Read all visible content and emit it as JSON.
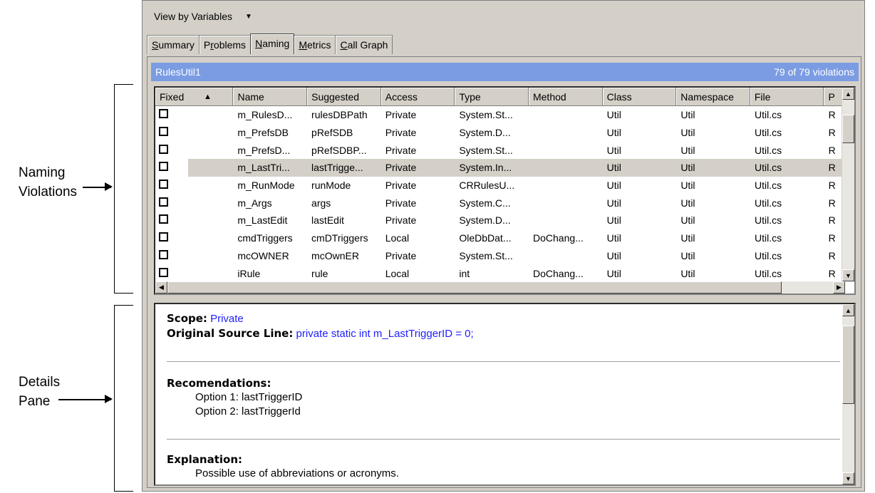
{
  "annotations": {
    "naming_violations": [
      "Naming",
      "Violations"
    ],
    "details_pane": [
      "Details",
      "Pane"
    ]
  },
  "toolbar": {
    "view_label": "View by Variables"
  },
  "tabs": [
    "Summary",
    "Problems",
    "Naming",
    "Metrics",
    "Call Graph"
  ],
  "tabs_active": "Naming",
  "banner": {
    "title": "RulesUtil1",
    "count": "79 of 79 violations",
    "color": "#7b9ce3"
  },
  "grid": {
    "columns": [
      "Fixed",
      "Name",
      "Suggested",
      "Access",
      "Type",
      "Method",
      "Class",
      "Namespace",
      "File",
      "P"
    ],
    "rows": [
      [
        "",
        "m_RulesD...",
        "rulesDBPath",
        "Private",
        "System.St...",
        "",
        "Util",
        "Util",
        "Util.cs",
        "R"
      ],
      [
        "",
        "m_PrefsDB",
        "pRefSDB",
        "Private",
        "System.D...",
        "",
        "Util",
        "Util",
        "Util.cs",
        "R"
      ],
      [
        "",
        "m_PrefsD...",
        "pRefSDBP...",
        "Private",
        "System.St...",
        "",
        "Util",
        "Util",
        "Util.cs",
        "R"
      ],
      [
        "",
        "m_LastTri...",
        "lastTrigge...",
        "Private",
        "System.In...",
        "",
        "Util",
        "Util",
        "Util.cs",
        "R"
      ],
      [
        "",
        "m_RunMode",
        "runMode",
        "Private",
        "CRRulesU...",
        "",
        "Util",
        "Util",
        "Util.cs",
        "R"
      ],
      [
        "",
        "m_Args",
        "args",
        "Private",
        "System.C...",
        "",
        "Util",
        "Util",
        "Util.cs",
        "R"
      ],
      [
        "",
        "m_LastEdit",
        "lastEdit",
        "Private",
        "System.D...",
        "",
        "Util",
        "Util",
        "Util.cs",
        "R"
      ],
      [
        "",
        "cmdTriggers",
        "cmDTriggers",
        "Local",
        "OleDbDat...",
        "DoChang...",
        "Util",
        "Util",
        "Util.cs",
        "R"
      ],
      [
        "",
        "mcOWNER",
        "mcOwnER",
        "Private",
        "System.St...",
        "",
        "Util",
        "Util",
        "Util.cs",
        "R"
      ],
      [
        "",
        "iRule",
        "rule",
        "Local",
        "int",
        "DoChang...",
        "Util",
        "Util",
        "Util.cs",
        "R"
      ]
    ],
    "selected_row": 3
  },
  "details": {
    "scope_label": "Scope:",
    "scope_value": "Private",
    "source_label": "Original Source Line:",
    "source_value": "private static int m_LastTriggerID = 0;",
    "recommend_label": "Recomendations:",
    "options": [
      "Option 1: lastTriggerID",
      "Option 2: lastTriggerId"
    ],
    "explanation_label": "Explanation:",
    "explanation_text": "Possible use of abbreviations or acronyms."
  }
}
